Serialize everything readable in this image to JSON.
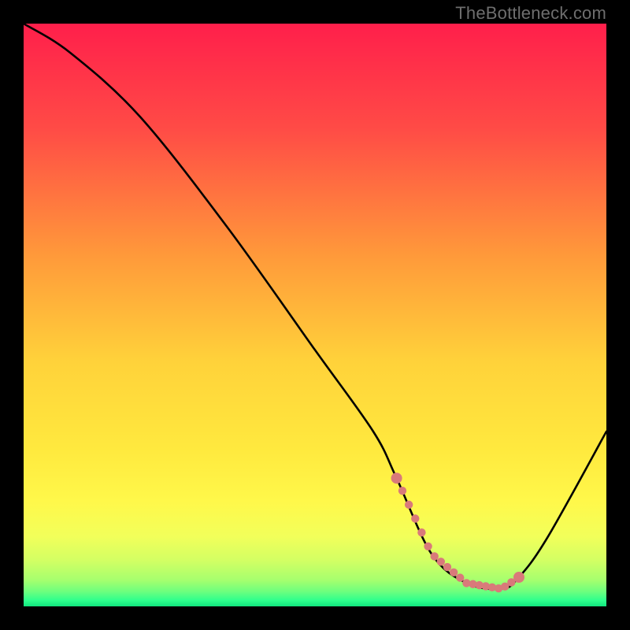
{
  "watermark": "TheBottleneck.com",
  "chart_data": {
    "type": "line",
    "title": "",
    "xlabel": "",
    "ylabel": "",
    "xlim": [
      0,
      100
    ],
    "ylim": [
      0,
      100
    ],
    "series": [
      {
        "name": "bottleneck-curve",
        "x": [
          0,
          8,
          20,
          35,
          50,
          60,
          64,
          70,
          76,
          82,
          85,
          90,
          100
        ],
        "y": [
          100,
          95,
          84,
          65,
          44,
          30,
          22,
          9,
          4,
          3,
          5,
          12,
          30
        ]
      }
    ],
    "highlight_range": {
      "x_start": 64,
      "x_end": 85
    },
    "gradient_stops": [
      {
        "pos": 0.0,
        "color": "#ff1f4b"
      },
      {
        "pos": 0.18,
        "color": "#ff4b46"
      },
      {
        "pos": 0.4,
        "color": "#ff9a3a"
      },
      {
        "pos": 0.58,
        "color": "#ffd23a"
      },
      {
        "pos": 0.73,
        "color": "#ffe93e"
      },
      {
        "pos": 0.82,
        "color": "#fff84a"
      },
      {
        "pos": 0.88,
        "color": "#f2ff5a"
      },
      {
        "pos": 0.92,
        "color": "#d4ff63"
      },
      {
        "pos": 0.955,
        "color": "#a6ff6e"
      },
      {
        "pos": 0.975,
        "color": "#6bff7e"
      },
      {
        "pos": 0.99,
        "color": "#2dff8d"
      },
      {
        "pos": 1.0,
        "color": "#11e57e"
      }
    ]
  }
}
